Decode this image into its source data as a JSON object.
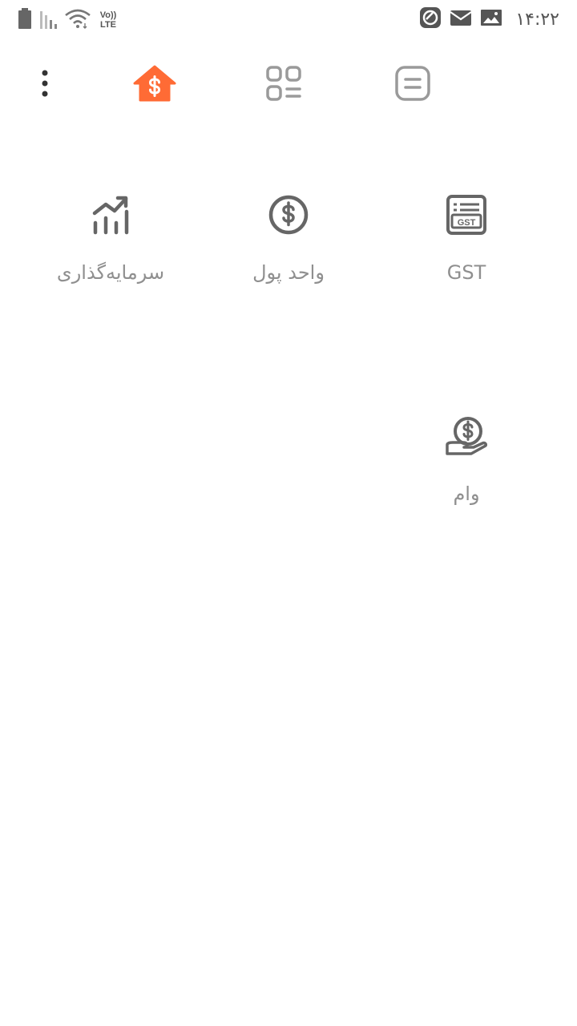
{
  "status_bar": {
    "time": "۱۴:۲۲",
    "network_top": "Vo))",
    "network_bottom": "LTE"
  },
  "top_nav": {
    "items": [
      {
        "icon": "more-vert-icon"
      },
      {
        "icon": "home-dollar-icon",
        "active": true
      },
      {
        "icon": "grid-list-icon"
      },
      {
        "icon": "notes-icon"
      }
    ]
  },
  "tools": [
    {
      "label": "GST",
      "icon": "gst-receipt-icon"
    },
    {
      "label": "واحد پول",
      "icon": "dollar-circle-icon"
    },
    {
      "label": "سرمایه‌گذاری",
      "icon": "trending-up-icon"
    },
    {
      "label": "وام",
      "icon": "hand-coin-icon"
    }
  ],
  "colors": {
    "accent": "#ff6b35",
    "icon": "#666666",
    "icon_light": "#9a9a9a",
    "label": "#8f8f8f"
  }
}
